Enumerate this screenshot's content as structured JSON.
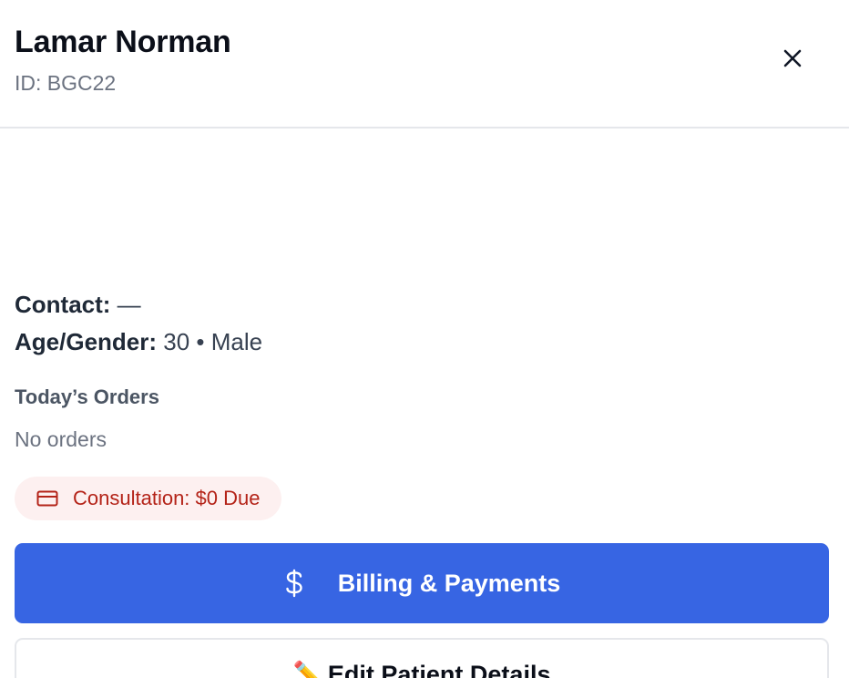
{
  "header": {
    "patient_name": "Lamar Norman",
    "patient_id": "ID: BGC22",
    "close_icon": "close-icon"
  },
  "details": {
    "contact_label": "Contact:",
    "contact_value": "—",
    "age_gender_label": "Age/Gender:",
    "age_gender_value": "30 • Male"
  },
  "orders": {
    "title": "Today’s Orders",
    "empty_text": "No orders"
  },
  "consultation_badge": {
    "icon": "credit-card-icon",
    "text": "Consultation: $0 Due",
    "color": "#b42318",
    "background": "#fdf0f0"
  },
  "actions": {
    "billing": {
      "icon": "dollar-icon",
      "label": "Billing & Payments",
      "color": "#3765e3"
    },
    "edit": {
      "icon": "pencil-icon",
      "icon_glyph": "✏️",
      "label": "Edit Patient Details"
    }
  }
}
